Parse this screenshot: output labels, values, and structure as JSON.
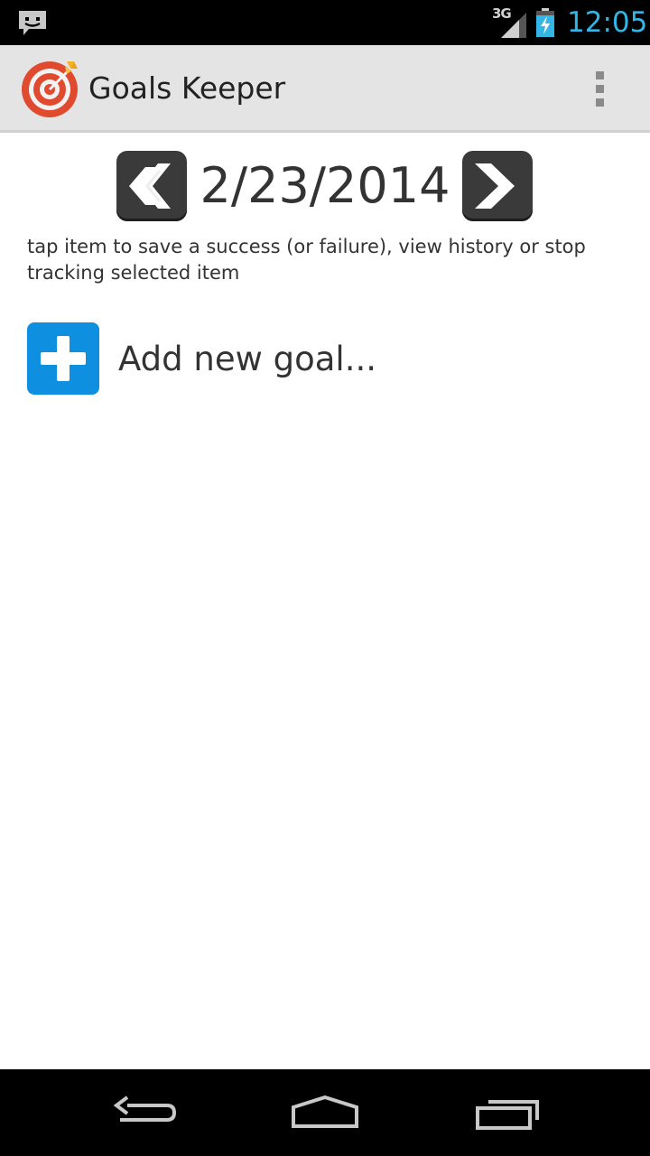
{
  "status_bar": {
    "network": "3G",
    "time": "12:05",
    "icons": [
      "notification-chat-icon",
      "signal-icon",
      "battery-charging-icon"
    ]
  },
  "action_bar": {
    "app_icon": "target-arrow-icon",
    "title": "Goals Keeper",
    "overflow_icon": "overflow-menu-icon"
  },
  "date_nav": {
    "date": "2/23/2014",
    "prev_icon": "chevron-left-icon",
    "next_icon": "chevron-right-icon"
  },
  "hint": "tap item to save a success (or failure), view history or stop tracking selected item",
  "add_goal": {
    "icon": "plus-icon",
    "label": "Add new goal..."
  },
  "nav_bar": {
    "icons": [
      "back-icon",
      "home-icon",
      "recent-apps-icon"
    ]
  },
  "colors": {
    "accent_blue": "#33b5e5",
    "add_button": "#0f8fe0",
    "nav_button": "#3a3a3a",
    "target_red": "#e04a2e"
  }
}
